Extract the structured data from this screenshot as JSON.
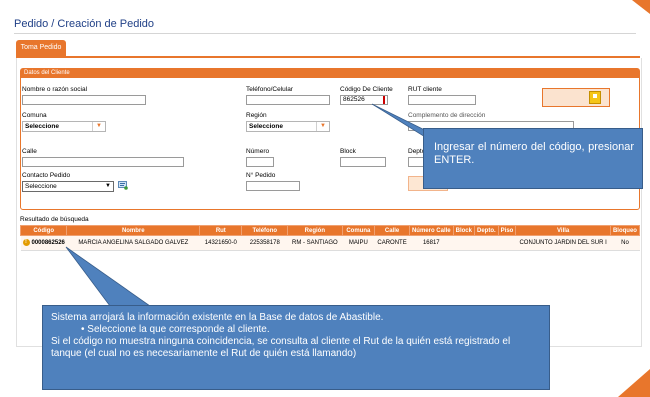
{
  "page": {
    "title": "Pedido / Creación de Pedido"
  },
  "tabs": [
    {
      "label": "Toma Pedido"
    }
  ],
  "cliente_section": {
    "header": "Datos del Cliente",
    "nombre_label": "Nombre o razón social",
    "nombre_value": "",
    "telefono_label": "Teléfono/Celular",
    "telefono_value": "",
    "codigo_label": "Código De Cliente",
    "codigo_value": "862526",
    "rut_label": "RUT cliente",
    "rut_value": "",
    "comuna_label": "Comuna",
    "comuna_value": "Seleccione",
    "region_label": "Región",
    "region_value": "Seleccione",
    "complemento_label": "Complemento de dirección",
    "calle_label": "Calle",
    "calle_value": "",
    "numero_label": "Número",
    "numero_value": "",
    "block_label": "Block",
    "block_value": "",
    "depto_label": "Depto",
    "contacto_label": "Contacto Pedido",
    "contacto_value": "Seleccione",
    "npedido_label": "N° Pedido",
    "npedido_value": ""
  },
  "results": {
    "label": "Resultado de búsqueda",
    "columns": [
      "Código",
      "Nombre",
      "Rut",
      "Teléfono",
      "Región",
      "Comuna",
      "Calle",
      "Número Calle",
      "Block",
      "Depto.",
      "Piso",
      "Villa",
      "Bloqueo"
    ],
    "rows": [
      {
        "codigo": "0000862526",
        "nombre": "MARCIA ANGELINA SALGADO GALVEZ",
        "rut": "14321650-0",
        "telefono": "225358178",
        "region": "RM - SANTIAGO",
        "comuna": "MAIPU",
        "calle": "CARONTE",
        "numero_calle": "16817",
        "block": "",
        "depto": "",
        "piso": "",
        "villa": "CONJUNTO JARDIN DEL SUR I",
        "bloqueo": "No"
      }
    ]
  },
  "callouts": {
    "codigo_tip": "Ingresar el número del código, presionar ENTER.",
    "result_line1": "Sistema arrojará la información existente en la Base de datos de Abastible.",
    "result_line2": "• Seleccione la que corresponde al cliente.",
    "result_line3": "Si el código no muestra ninguna coincidencia, se consulta al cliente el Rut de  la quién está registrado el tanque (el cual no es necesariamente el Rut de quién está llamando)"
  },
  "colors": {
    "accent": "#e8762c",
    "title": "#1f3f86",
    "callout": "#4f81bd"
  },
  "icons": {
    "save": "save-icon",
    "warning": "warning-icon",
    "contact": "contact-edit-icon"
  }
}
